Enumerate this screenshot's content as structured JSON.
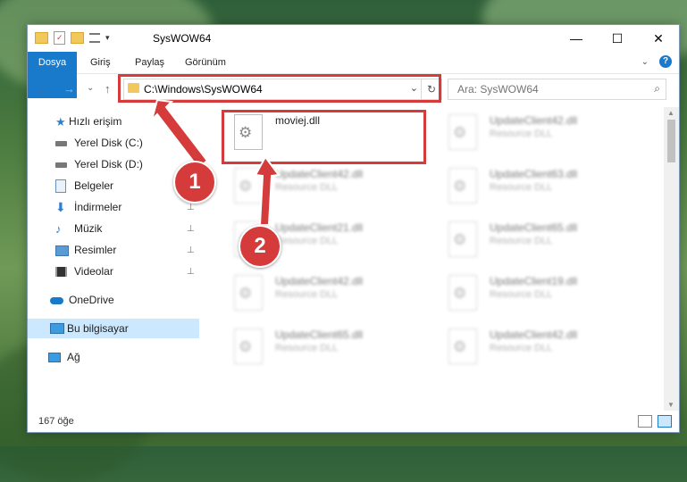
{
  "window": {
    "title": "SysWOW64",
    "controls": {
      "minimize": "—",
      "maximize": "☐",
      "close": "✕"
    }
  },
  "ribbon": {
    "tabs": [
      "Dosya",
      "Giriş",
      "Paylaş",
      "Görünüm"
    ],
    "expand_label": "⌄",
    "help_label": "?"
  },
  "nav": {
    "back": "←",
    "forward": "→",
    "recent": "⌄",
    "up": "↑",
    "address": "C:\\Windows\\SysWOW64",
    "dropdown": "⌄",
    "refresh": "↻",
    "search_placeholder": "Ara: SysWOW64",
    "search_icon": "⌕"
  },
  "sidebar": {
    "items": [
      {
        "label": "Hızlı erişim",
        "icon": "star-icon",
        "pinned": false,
        "selected": false
      },
      {
        "label": "Yerel Disk (C:)",
        "icon": "drive-icon",
        "pinned": true,
        "selected": false
      },
      {
        "label": "Yerel Disk (D:)",
        "icon": "drive-icon",
        "pinned": false,
        "selected": false
      },
      {
        "label": "Belgeler",
        "icon": "documents-icon",
        "pinned": true,
        "selected": false
      },
      {
        "label": "İndirmeler",
        "icon": "download-icon",
        "pinned": true,
        "selected": false
      },
      {
        "label": "Müzik",
        "icon": "music-icon",
        "pinned": true,
        "selected": false
      },
      {
        "label": "Resimler",
        "icon": "pictures-icon",
        "pinned": true,
        "selected": false
      },
      {
        "label": "Videolar",
        "icon": "video-icon",
        "pinned": true,
        "selected": false
      },
      {
        "label": "OneDrive",
        "icon": "cloud-icon",
        "pinned": false,
        "selected": false
      },
      {
        "label": "Bu bilgisayar",
        "icon": "computer-icon",
        "pinned": false,
        "selected": true
      },
      {
        "label": "Ağ",
        "icon": "network-icon",
        "pinned": false,
        "selected": false
      }
    ],
    "pin_glyph": "📌"
  },
  "files": [
    {
      "name": "moviej.dll",
      "type": "",
      "blurred": false
    },
    {
      "name": "UpdateClient42.dll",
      "type": "Resource DLL",
      "blurred": true
    },
    {
      "name": "UpdateClient42.dll",
      "type": "Resource DLL",
      "blurred": true
    },
    {
      "name": "UpdateClient63.dll",
      "type": "Resource DLL",
      "blurred": true
    },
    {
      "name": "UpdateClient21.dll",
      "type": "Resource DLL",
      "blurred": true
    },
    {
      "name": "UpdateClient65.dll",
      "type": "Resource DLL",
      "blurred": true
    },
    {
      "name": "UpdateClient42.dll",
      "type": "Resource DLL",
      "blurred": true
    },
    {
      "name": "UpdateClient19.dll",
      "type": "Resource DLL",
      "blurred": true
    },
    {
      "name": "UpdateClient65.dll",
      "type": "Resource DLL",
      "blurred": true
    },
    {
      "name": "UpdateClient42.dll",
      "type": "Resource DLL",
      "blurred": true
    }
  ],
  "status": {
    "count": "167 öğe"
  },
  "annotations": {
    "step1": "1",
    "step2": "2",
    "color": "#d53b3b"
  }
}
